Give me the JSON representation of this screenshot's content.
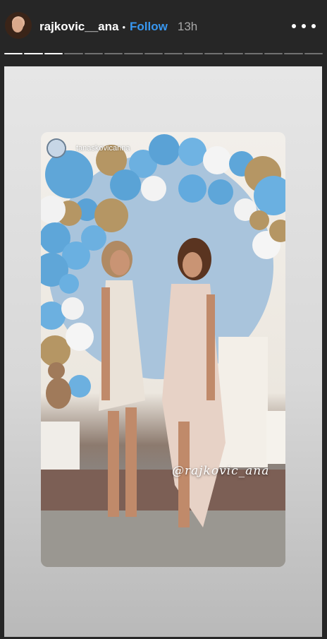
{
  "header": {
    "username": "rajkovic__ana",
    "separator": "•",
    "follow_label": "Follow",
    "time_ago": "13h",
    "more_icon": "more-horizontal-icon"
  },
  "progress": {
    "segments_total": 16,
    "segments_viewed": 3
  },
  "story": {
    "repost_username": "tanaskovicanna",
    "mention_sticker": "@rajkovic_ana"
  },
  "colors": {
    "background": "#262626",
    "follow": "#3897f0",
    "time": "#a8a8a8"
  }
}
